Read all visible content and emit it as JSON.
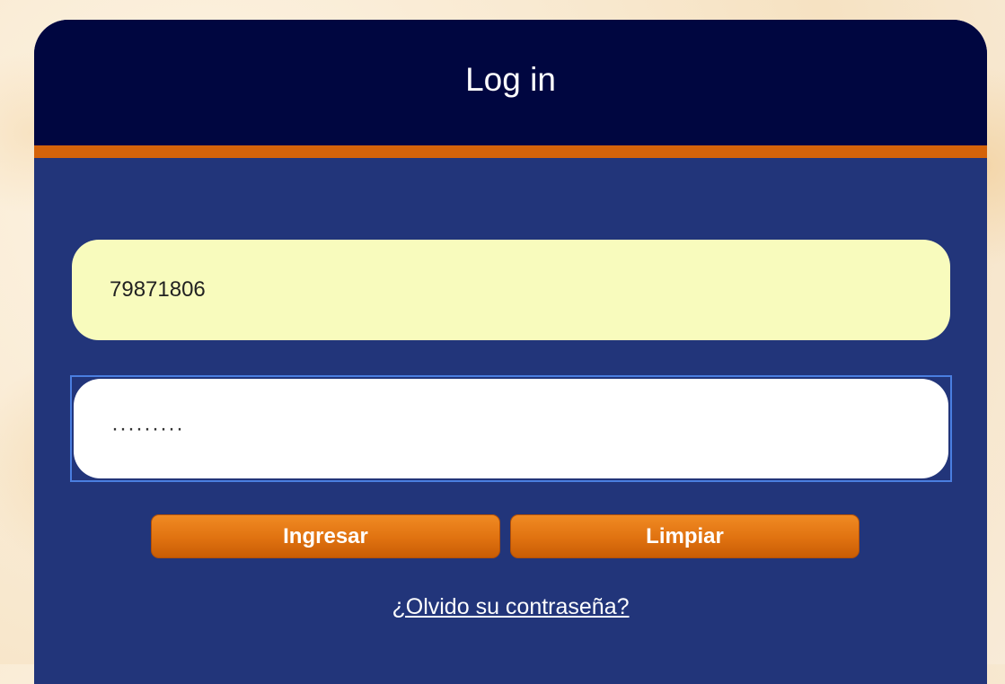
{
  "login": {
    "title": "Log in",
    "username_value": "79871806",
    "password_value": "·········",
    "buttons": {
      "submit_label": "Ingresar",
      "clear_label": "Limpiar"
    },
    "forgot_password_label": "¿Olvido su contraseña?"
  },
  "colors": {
    "header_bg": "#000640",
    "card_bg": "#22357a",
    "accent_bar": "#d4630a",
    "username_bg": "#f8fbbd",
    "button_orange": "#e07210"
  }
}
